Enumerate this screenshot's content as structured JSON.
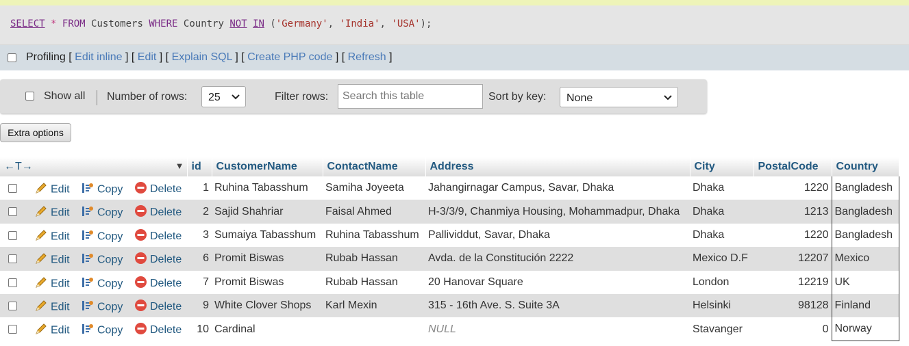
{
  "sql": {
    "t1": "SELECT",
    "t2": " ",
    "t3": "*",
    "t4": " ",
    "t5": "FROM",
    "t6": " Customers ",
    "t7": "WHERE",
    "t8": " Country ",
    "t9": "NOT",
    "t10": " ",
    "t11": "IN",
    "t12": " (",
    "t13": "'Germany'",
    "t14": ", ",
    "t15": "'India'",
    "t16": ", ",
    "t17": "'USA'",
    "t18": ");"
  },
  "profiling": {
    "label": "Profiling",
    "open": " [ ",
    "sep": " ] [ ",
    "close": " ]",
    "edit_inline": "Edit inline",
    "edit": "Edit",
    "explain": "Explain SQL",
    "php": "Create PHP code",
    "refresh": "Refresh"
  },
  "nav": {
    "show_all": "Show all",
    "rows_label": "Number of rows:",
    "rows_value": "25",
    "filter_label": "Filter rows:",
    "filter_placeholder": "Search this table",
    "sort_label": "Sort by key:",
    "sort_value": "None"
  },
  "extra_options": "Extra options",
  "table": {
    "arrows": "←T→",
    "sort_icon": "▼",
    "columns": [
      "id",
      "CustomerName",
      "ContactName",
      "Address",
      "City",
      "PostalCode",
      "Country"
    ],
    "actions": {
      "edit": "Edit",
      "copy": "Copy",
      "delete": "Delete"
    },
    "rows": [
      [
        "1",
        "Ruhina Tabasshum",
        "Samiha Joyeeta",
        "Jahangirnagar Campus, Savar, Dhaka",
        "Dhaka",
        "1220",
        "Bangladesh"
      ],
      [
        "2",
        "Sajid Shahriar",
        "Faisal Ahmed",
        "H-3/3/9, Chanmiya Housing, Mohammadpur, Dhaka",
        "Dhaka",
        "1213",
        "Bangladesh"
      ],
      [
        "3",
        "Sumaiya Tabasshum",
        "Ruhina Tabasshum",
        "Pallividdut, Savar, Dhaka",
        "Dhaka",
        "1220",
        "Bangladesh"
      ],
      [
        "6",
        "Promit Biswas",
        "Rubab Hassan",
        "Avda. de la Constitución 2222",
        "Mexico D.F",
        "12207",
        "Mexico"
      ],
      [
        "7",
        "Promit Biswas",
        "Rubab Hassan",
        "20 Hanovar Square",
        "London",
        "12219",
        "UK"
      ],
      [
        "9",
        "White Clover Shops",
        "Karl Mexin",
        "315 - 16th Ave. S. Suite 3A",
        "Helsinki",
        "98128",
        "Finland"
      ],
      [
        "10",
        "Cardinal",
        "",
        "NULL",
        "Stavanger",
        "0",
        "Norway"
      ]
    ]
  },
  "colors": {
    "header_text": "#235a81",
    "link": "#4a7ab8",
    "sql_keyword": "#7a2b86",
    "sql_string": "#a5322b"
  }
}
